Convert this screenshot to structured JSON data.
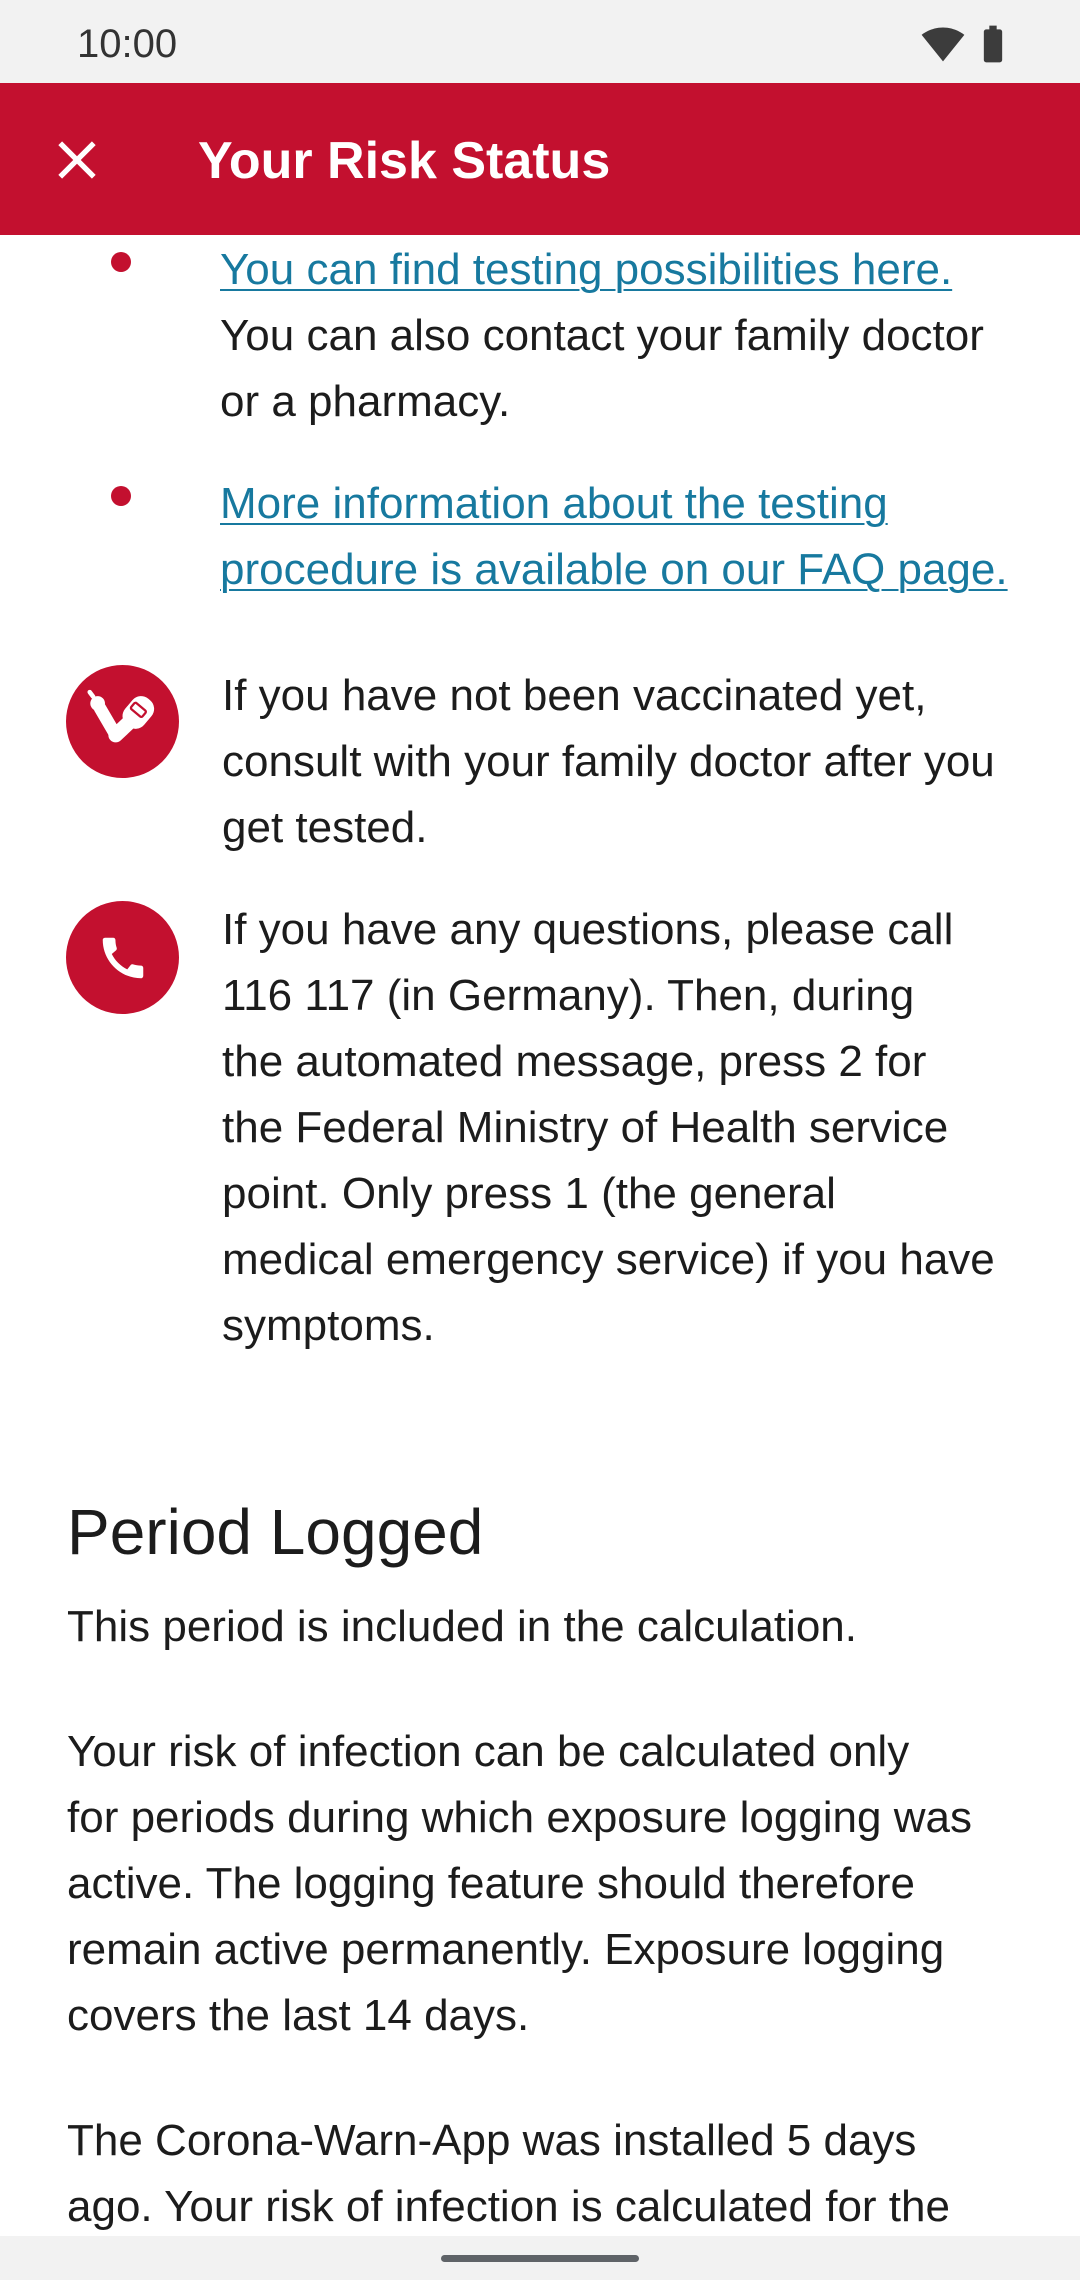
{
  "status_bar": {
    "time": "10:00",
    "icons": [
      "wifi-icon",
      "battery-icon"
    ]
  },
  "app_bar": {
    "title": "Your Risk Status",
    "close_icon": "close-icon"
  },
  "testing_list": {
    "items": [
      {
        "link_lines": [
          "You can find testing possibilities here."
        ],
        "text_lines": [
          "You can also contact your family doctor",
          "or a pharmacy."
        ]
      },
      {
        "link_lines": [
          "More information about the testing",
          "procedure is available on our FAQ page."
        ]
      }
    ]
  },
  "advice": [
    {
      "icon": "vaccination-icon",
      "lines": [
        "If you have not been vaccinated yet,",
        "consult with your family doctor after you",
        "get tested."
      ]
    },
    {
      "icon": "phone-icon",
      "lines": [
        "If you have any questions, please call",
        "116 117 (in Germany). Then, during",
        "the automated message, press 2 for",
        "the Federal Ministry of Health service",
        "point. Only press 1 (the general",
        "medical emergency service) if you have",
        "symptoms."
      ]
    }
  ],
  "period_logged": {
    "title": "Period Logged",
    "subtitle": "This period is included in the calculation.",
    "paragraphs": [
      {
        "lines": [
          "Your risk of infection can be calculated only",
          "for periods during which exposure logging was",
          "active. The logging feature should therefore",
          "remain active permanently. Exposure logging",
          "covers the last 14 days."
        ]
      },
      {
        "lines": [
          "The Corona-Warn-App was installed 5 days",
          "ago. Your risk of infection is calculated for the"
        ]
      }
    ]
  },
  "colors": {
    "accent": "#c3102f",
    "link": "#17799f",
    "text": "#1c1c1c",
    "system_bars": "#f2f2f2"
  }
}
